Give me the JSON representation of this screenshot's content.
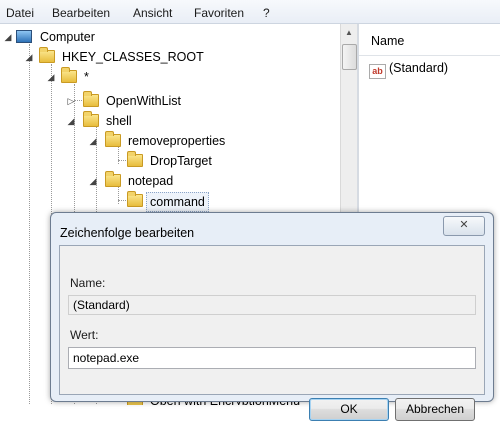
{
  "menu": {
    "items": [
      "Datei",
      "Bearbeiten",
      "Ansicht",
      "Favoriten",
      "?"
    ]
  },
  "tree": {
    "computer": "Computer",
    "hkcr": "HKEY_CLASSES_ROOT",
    "star": "*",
    "openwithlist": "OpenWithList",
    "shell": "shell",
    "removeproperties": "removeproperties",
    "droptarget": "DropTarget",
    "notepad": "notepad",
    "command": "command",
    "hidden_bottom": "Open with EncryptionMenu"
  },
  "list": {
    "header_name": "Name",
    "value_name": "(Standard)"
  },
  "dialog": {
    "title": "Zeichenfolge bearbeiten",
    "close_symbol": "✕",
    "name_label": "Name:",
    "name_value": "(Standard)",
    "value_label": "Wert:",
    "value_text": "notepad.exe",
    "ok_label": "OK",
    "cancel_label": "Abbrechen"
  },
  "colors": {
    "folder": "#e7bd3d",
    "dialog_frame": "#e7eef7",
    "accent_button": "#3c7fb1"
  }
}
